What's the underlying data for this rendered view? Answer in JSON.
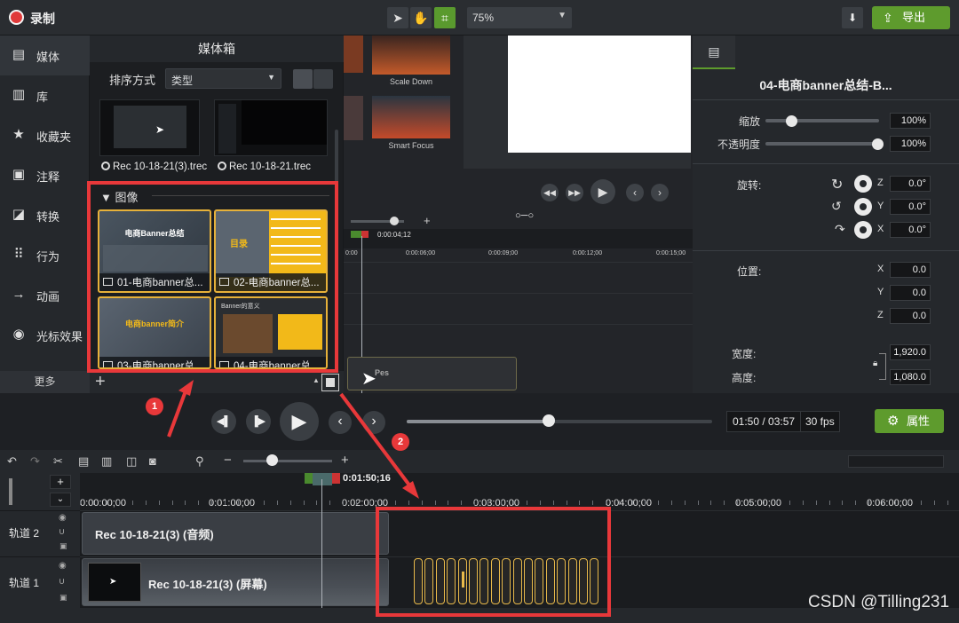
{
  "topbar": {
    "record_label": "录制",
    "zoom": "75%",
    "export_label": "导出"
  },
  "sidebar": {
    "items": [
      {
        "label": "媒体",
        "icon": "media-bin-icon"
      },
      {
        "label": "库",
        "icon": "library-icon"
      },
      {
        "label": "收藏夹",
        "icon": "star-icon"
      },
      {
        "label": "注释",
        "icon": "annotation-icon"
      },
      {
        "label": "转换",
        "icon": "transition-icon"
      },
      {
        "label": "行为",
        "icon": "behavior-icon"
      },
      {
        "label": "动画",
        "icon": "animation-icon"
      },
      {
        "label": "光标效果",
        "icon": "cursor-effect-icon"
      }
    ],
    "more_label": "更多"
  },
  "media_bin": {
    "title": "媒体箱",
    "sort_label": "排序方式",
    "sort_value": "类型",
    "clips": [
      "Rec 10-18-21(3).trec",
      "Rec 10-18-21.trec"
    ],
    "images_section": "图像",
    "images": [
      {
        "label": "01-电商banner总...",
        "thumb_text": "电商Banner总结"
      },
      {
        "label": "02-电商banner总...",
        "thumb_text": "目录"
      },
      {
        "label": "03-电商banner总...",
        "thumb_text": "电商banner简介"
      },
      {
        "label": "04-电商banner总...",
        "thumb_text": "Banner的意义"
      }
    ]
  },
  "library_preview": {
    "scale_down": "Scale Down",
    "smart_focus": "Smart Focus"
  },
  "mini_timeline": {
    "playhead": "0:00:04;12",
    "ticks": [
      "0:00",
      "0:00:06;00",
      "0:00:09;00",
      "0:00:12;00",
      "0:00:15;00"
    ],
    "clip_text": "Pes"
  },
  "properties": {
    "title": "04-电商banner总结-B...",
    "scale_label": "缩放",
    "scale_value": "100%",
    "scale_level": 1.0,
    "opacity_label": "不透明度",
    "opacity_value": "100%",
    "opacity_level": 1.0,
    "rotation_label": "旋转:",
    "rotation": [
      {
        "axis": "Z",
        "value": "0.0°"
      },
      {
        "axis": "Y",
        "value": "0.0°"
      },
      {
        "axis": "X",
        "value": "0.0°"
      }
    ],
    "position_label": "位置:",
    "position": [
      {
        "axis": "X",
        "value": "0.0"
      },
      {
        "axis": "Y",
        "value": "0.0"
      },
      {
        "axis": "Z",
        "value": "0.0"
      }
    ],
    "width_label": "宽度:",
    "width_value": "1,920.0",
    "height_label": "高度:",
    "height_value": "1,080.0"
  },
  "transport": {
    "time": "01:50 / 03:57",
    "fps": "30 fps",
    "progress": 0.466,
    "props_label": "属性"
  },
  "timeline": {
    "playhead": "0:01:50;16",
    "ruler": [
      "0:00:00;00",
      "0:01:00;00",
      "0:02:00;00",
      "0:03:00;00",
      "0:04:00;00",
      "0:05:00;00",
      "0:06:00;00"
    ],
    "tracks": [
      {
        "name": "轨道 2",
        "clip": "Rec 10-18-21(3) (音频)"
      },
      {
        "name": "轨道 1",
        "clip": "Rec 10-18-21(3) (屏幕)"
      }
    ]
  },
  "annotations": {
    "badge1": "1",
    "badge2": "2"
  },
  "watermark": "CSDN @Tilling231",
  "colors": {
    "accent": "#5e9b2d",
    "highlight": "#e8383a",
    "image_border": "#e6b13a"
  }
}
